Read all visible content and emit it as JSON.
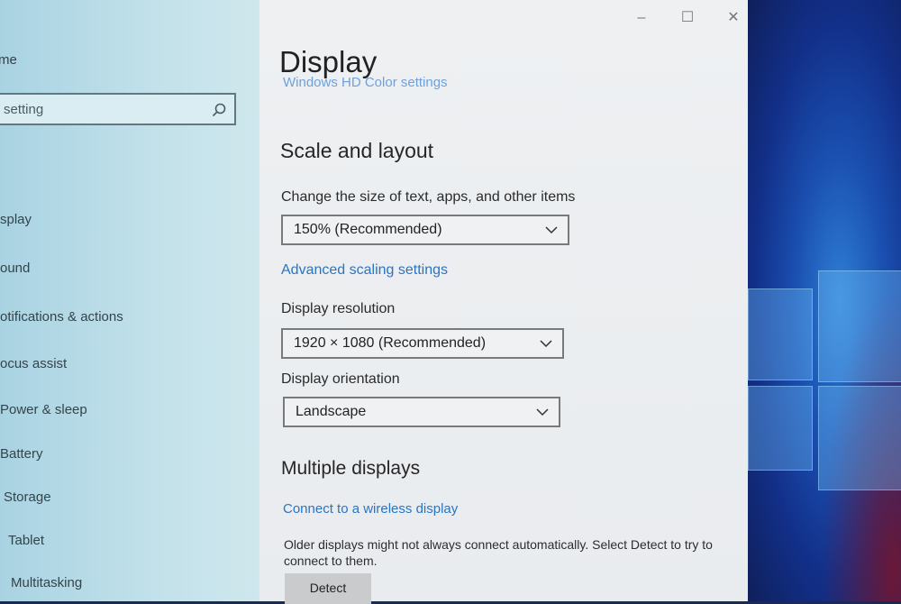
{
  "nav": {
    "home_label": "me",
    "search_placeholder": "setting",
    "items": [
      "splay",
      "ound",
      "otifications & actions",
      "ocus assist",
      "Power & sleep",
      "Battery",
      "Storage",
      "Tablet",
      "Multitasking"
    ]
  },
  "content": {
    "page_title": "Display",
    "cut_link": "Windows HD Color settings",
    "scale_section": {
      "heading": "Scale and layout",
      "size_label": "Change the size of text, apps, and other items",
      "size_value": "150% (Recommended)",
      "advanced_link": "Advanced scaling settings",
      "resolution_label": "Display resolution",
      "resolution_value": "1920 × 1080 (Recommended)",
      "orientation_label": "Display orientation",
      "orientation_value": "Landscape"
    },
    "multi_section": {
      "heading": "Multiple displays",
      "wireless_link": "Connect to a wireless display",
      "description": "Older displays might not always connect automatically. Select Detect to try to connect to them.",
      "detect_label": "Detect"
    }
  },
  "titlebar": {
    "minimize": "–",
    "maximize": "☐",
    "close": "✕"
  },
  "colors": {
    "accent": "#2a74c4",
    "nav_bg": "#c2e1ea",
    "content_bg": "#eef0f2"
  }
}
